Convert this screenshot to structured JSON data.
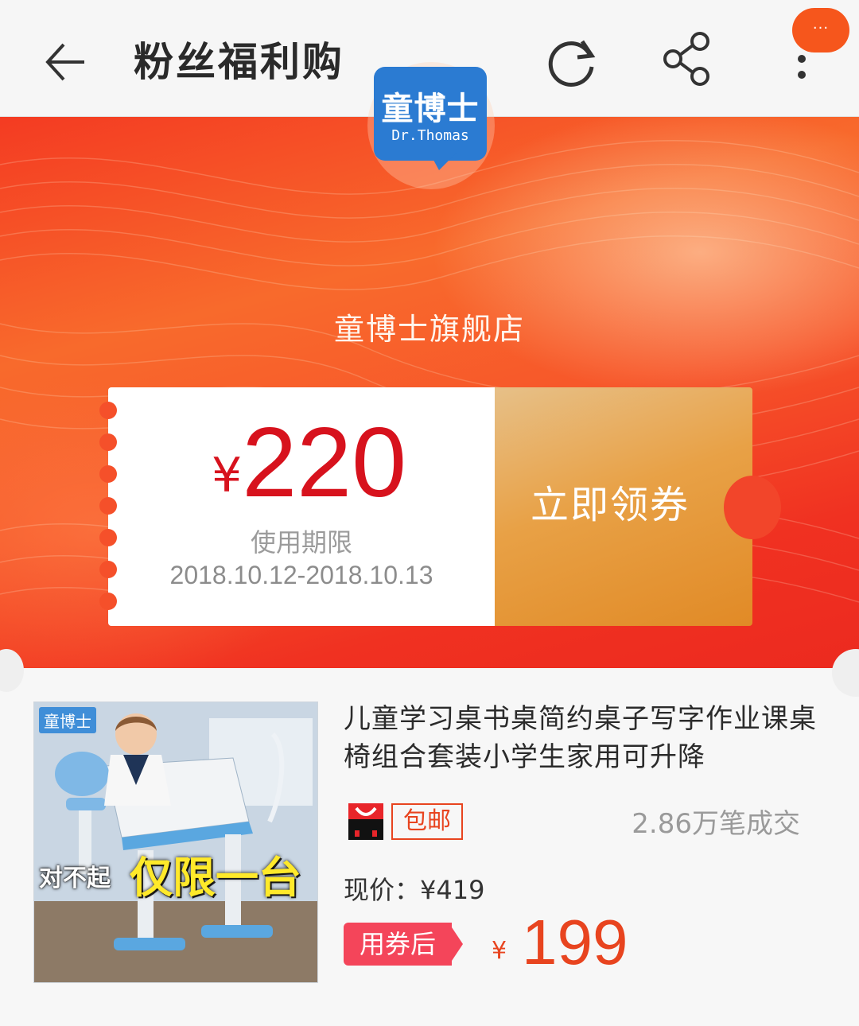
{
  "header": {
    "title": "粉丝福利购",
    "more_badge": "···",
    "icons": [
      "back-arrow-icon",
      "refresh-icon",
      "share-icon",
      "more-vertical-icon"
    ]
  },
  "store": {
    "logo_text_cn": "童博士",
    "logo_text_en": "Dr.Thomas",
    "name": "童博士旗舰店"
  },
  "coupon": {
    "currency": "¥",
    "amount": "220",
    "validity_label": "使用期限",
    "validity_dates": "2018.10.12-2018.10.13",
    "claim_label": "立即领券"
  },
  "product": {
    "image_brand": "童博士",
    "image_overlay_small": "对不起",
    "image_overlay_big": "仅限一台",
    "title": "儿童学习桌书桌简约桌子写字作业课桌椅组合套装小学生家用可升降",
    "free_shipping": "包邮",
    "sales": "2.86万笔成交",
    "current_price_label": "现价：¥419",
    "after_coupon_label": "用券后",
    "final_currency": "¥",
    "final_price": "199"
  },
  "colors": {
    "accent": "#e8441f",
    "coupon_red": "#d7121d",
    "brand_blue": "#2b7bd2",
    "tag_pink": "#f4455a"
  }
}
